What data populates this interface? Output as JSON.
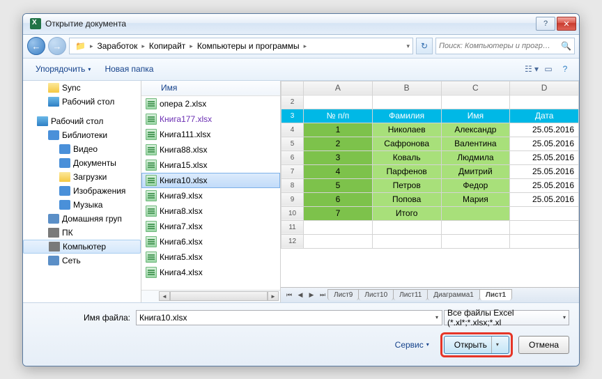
{
  "title": "Открытие документа",
  "breadcrumb": [
    "Заработок",
    "Копирайт",
    "Компьютеры и программы"
  ],
  "search_placeholder": "Поиск: Компьютеры и прогр…",
  "toolbar": {
    "organize": "Упорядочить",
    "newfolder": "Новая папка"
  },
  "sidebar": [
    {
      "label": "Sync",
      "icon": "ico-folder",
      "indent": 1
    },
    {
      "label": "Рабочий стол",
      "icon": "ico-desktop",
      "indent": 1
    },
    {
      "label": "Рабочий стол",
      "icon": "ico-desktop",
      "indent": 0,
      "group": true
    },
    {
      "label": "Библиотеки",
      "icon": "ico-lib",
      "indent": 1
    },
    {
      "label": "Видео",
      "icon": "ico-lib",
      "indent": 2
    },
    {
      "label": "Документы",
      "icon": "ico-lib",
      "indent": 2
    },
    {
      "label": "Загрузки",
      "icon": "ico-folder",
      "indent": 2
    },
    {
      "label": "Изображения",
      "icon": "ico-lib",
      "indent": 2
    },
    {
      "label": "Музыка",
      "icon": "ico-lib",
      "indent": 2
    },
    {
      "label": "Домашняя груп",
      "icon": "ico-net",
      "indent": 1
    },
    {
      "label": "ПК",
      "icon": "ico-comp",
      "indent": 1
    },
    {
      "label": "Компьютер",
      "icon": "ico-comp",
      "indent": 1,
      "selected": true
    },
    {
      "label": "Сеть",
      "icon": "ico-net",
      "indent": 1
    }
  ],
  "file_header": "Имя",
  "files": [
    {
      "name": "опера 2.xlsx"
    },
    {
      "name": "Книга177.xlsx",
      "visited": true
    },
    {
      "name": "Книга111.xlsx"
    },
    {
      "name": "Книга88.xlsx"
    },
    {
      "name": "Книга15.xlsx"
    },
    {
      "name": "Книга10.xlsx",
      "selected": true
    },
    {
      "name": "Книга9.xlsx"
    },
    {
      "name": "Книга8.xlsx"
    },
    {
      "name": "Книга7.xlsx"
    },
    {
      "name": "Книга6.xlsx"
    },
    {
      "name": "Книга5.xlsx"
    },
    {
      "name": "Книга4.xlsx"
    }
  ],
  "chart_data": {
    "type": "table",
    "columns": [
      "A",
      "B",
      "C",
      "D"
    ],
    "headers": {
      "idx": "№ п/п",
      "fam": "Фамилия",
      "name": "Имя",
      "date": "Дата"
    },
    "rows": [
      {
        "n": "1",
        "fam": "Николаев",
        "name": "Александр",
        "date": "25.05.2016"
      },
      {
        "n": "2",
        "fam": "Сафронова",
        "name": "Валентина",
        "date": "25.05.2016"
      },
      {
        "n": "3",
        "fam": "Коваль",
        "name": "Людмила",
        "date": "25.05.2016"
      },
      {
        "n": "4",
        "fam": "Парфенов",
        "name": "Дмитрий",
        "date": "25.05.2016"
      },
      {
        "n": "5",
        "fam": "Петров",
        "name": "Федор",
        "date": "25.05.2016"
      },
      {
        "n": "6",
        "fam": "Попова",
        "name": "Мария",
        "date": "25.05.2016"
      },
      {
        "n": "7",
        "fam": "Итого",
        "name": "",
        "date": ""
      }
    ],
    "row_numbers": [
      2,
      3,
      4,
      5,
      6,
      7,
      8,
      9,
      10,
      11,
      12
    ]
  },
  "sheet_tabs": [
    "Лист9",
    "Лист10",
    "Лист11",
    "Диаграмма1",
    "Лист1"
  ],
  "active_tab": "Лист1",
  "bottom": {
    "filename_label": "Имя файла:",
    "filename_value": "Книга10.xlsx",
    "filetype": "Все файлы Excel (*.xl*;*.xlsx;*.xl",
    "service": "Сервис",
    "open": "Открыть",
    "cancel": "Отмена"
  }
}
